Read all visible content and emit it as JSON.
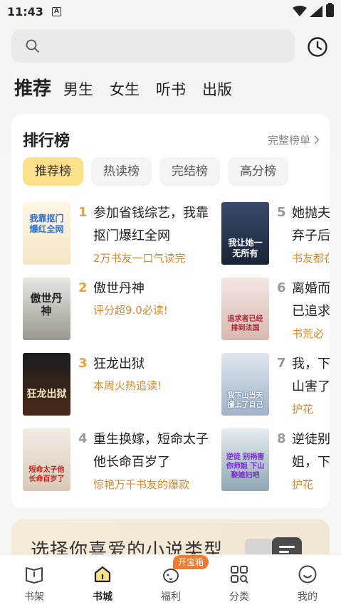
{
  "status": {
    "time": "11:43",
    "notif_letter": "A"
  },
  "search": {
    "placeholder": ""
  },
  "top_tabs": [
    "推荐",
    "男生",
    "女生",
    "听书",
    "出版"
  ],
  "ranking": {
    "title": "排行榜",
    "more_label": "完整榜单",
    "chips": [
      "推荐榜",
      "热读榜",
      "完结榜",
      "高分榜"
    ],
    "books": [
      {
        "rank": "1",
        "title": "参加省钱综艺，我靠抠门爆红全网",
        "tag": "2万书友一口气读完",
        "cover_text": "我靠抠门爆红全网"
      },
      {
        "rank": "2",
        "title": "傲世丹神",
        "tag": "评分超9.0必读!",
        "cover_text": "傲世丹神"
      },
      {
        "rank": "3",
        "title": "狂龙出狱",
        "tag": "本周火热追读!",
        "cover_text": "狂龙出狱"
      },
      {
        "rank": "4",
        "title": "重生换嫁，短命太子他长命百岁了",
        "tag": "惊艳万千书友的爆款",
        "cover_text": "短命太子他长命百岁了"
      },
      {
        "rank": "5",
        "title": "她抛夫弃子后让她一无所有",
        "tag": "书友都在",
        "cover_text": "我让她一无所有"
      },
      {
        "rank": "6",
        "title": "离婚而已追求者",
        "tag": "书荒必",
        "cover_text": "追求者已经排到法国"
      },
      {
        "rank": "7",
        "title": "我，下山害了自",
        "tag": "护花",
        "cover_text": "我下山当天撞上了自己"
      },
      {
        "rank": "8",
        "title": "逆徒别姐，下",
        "tag": "护花",
        "cover_text": "逆徒 别祸害你师姐 下山娶媳妇吧"
      }
    ]
  },
  "banner": {
    "text": "选择你喜爱的小说类型"
  },
  "bottom_nav": {
    "items": [
      "书架",
      "书城",
      "福利",
      "分类",
      "我的"
    ],
    "badge": "开宝箱",
    "active": "书城"
  },
  "colors": {
    "accent": "#fde08a",
    "rank_top": "#e9a23b",
    "rank_other": "#999999",
    "tag": "#d9892e",
    "badge": "#f07a2d"
  }
}
